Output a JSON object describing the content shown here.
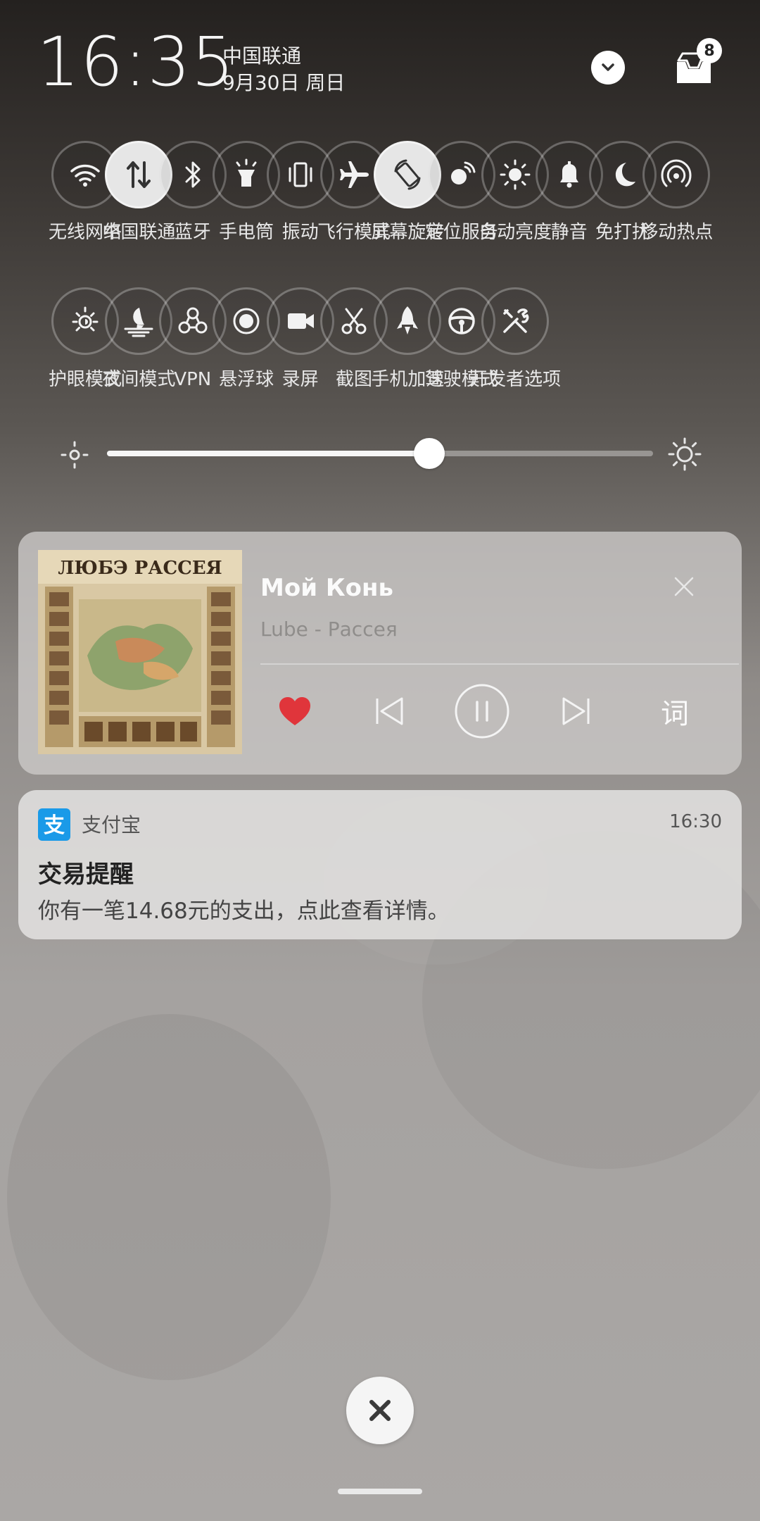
{
  "status": {
    "time": "16:35",
    "carrier": "中国联通",
    "date": "9月30日 周日",
    "inbox_badge": "8"
  },
  "quick_tiles_row1": [
    {
      "label": "无线网络",
      "icon": "wifi-icon",
      "on": false
    },
    {
      "label": "中国联通",
      "icon": "mobile-data-icon",
      "on": true
    },
    {
      "label": "蓝牙",
      "icon": "bluetooth-icon",
      "on": false
    },
    {
      "label": "手电筒",
      "icon": "flashlight-icon",
      "on": false
    },
    {
      "label": "振动",
      "icon": "vibrate-icon",
      "on": false
    },
    {
      "label": "飞行模式",
      "icon": "airplane-icon",
      "on": false
    },
    {
      "label": "屏幕旋转",
      "icon": "rotate-icon",
      "on": true
    },
    {
      "label": "定位服务",
      "icon": "location-icon",
      "on": false
    },
    {
      "label": "自动亮度",
      "icon": "auto-brightness-icon",
      "on": false
    },
    {
      "label": "静音",
      "icon": "bell-icon",
      "on": false
    },
    {
      "label": "免打扰",
      "icon": "moon-icon",
      "on": false
    },
    {
      "label": "移动热点",
      "icon": "hotspot-icon",
      "on": false
    }
  ],
  "quick_tiles_row2": [
    {
      "label": "护眼模式",
      "icon": "eye-care-icon",
      "on": false
    },
    {
      "label": "夜间模式",
      "icon": "night-mode-icon",
      "on": false
    },
    {
      "label": "VPN",
      "icon": "vpn-icon",
      "on": false
    },
    {
      "label": "悬浮球",
      "icon": "floating-ball-icon",
      "on": false
    },
    {
      "label": "录屏",
      "icon": "screen-record-icon",
      "on": false
    },
    {
      "label": "截图",
      "icon": "screenshot-icon",
      "on": false
    },
    {
      "label": "手机加速",
      "icon": "rocket-icon",
      "on": false
    },
    {
      "label": "驾驶模式",
      "icon": "steering-wheel-icon",
      "on": false
    },
    {
      "label": "开发者选项",
      "icon": "developer-tools-icon",
      "on": false
    }
  ],
  "brightness": {
    "level": 0.59
  },
  "music": {
    "title": "Мой Конь",
    "artist": "Lube - Рассея",
    "album_art_text": "ЛЮБЭ РАССЕЯ",
    "lyrics_label": "词",
    "favorited": true,
    "playing": true
  },
  "notification": {
    "app_name": "支付宝",
    "app_icon_glyph": "支",
    "time": "16:30",
    "title": "交易提醒",
    "body": "你有一笔14.68元的支出，点此查看详情。"
  },
  "colors": {
    "heart": "#e0353b",
    "alipay_blue": "#1a9ae8"
  }
}
